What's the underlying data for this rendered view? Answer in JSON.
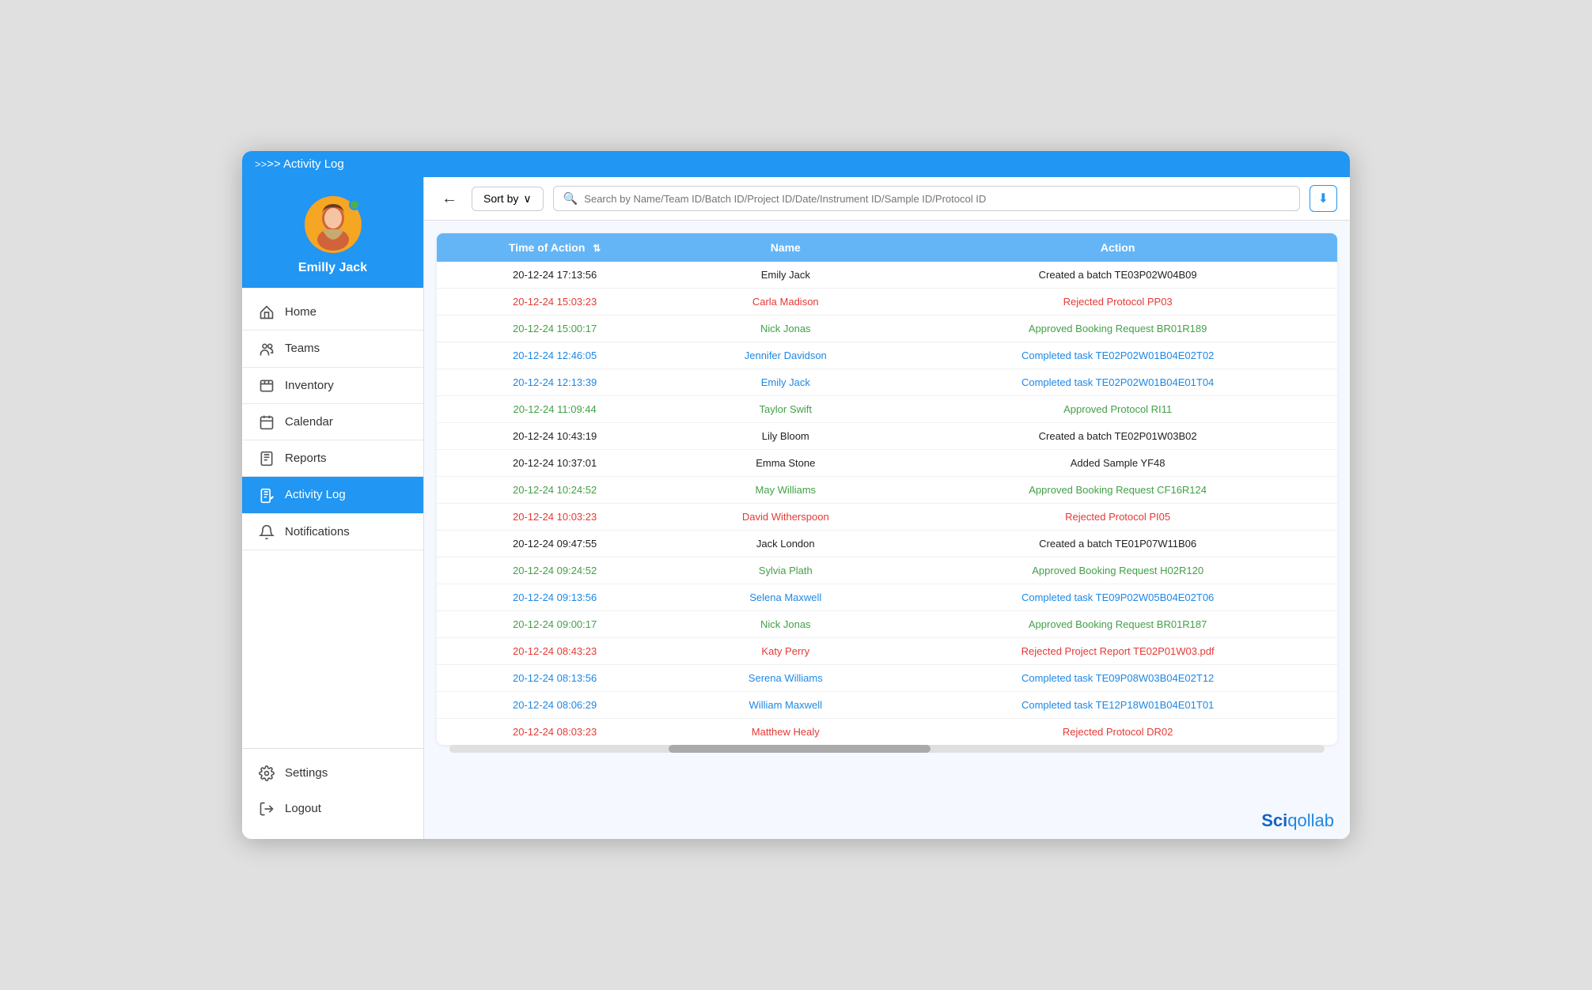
{
  "window": {
    "title": ">> Activity Log"
  },
  "sidebar": {
    "profile": {
      "name": "Emilly Jack",
      "online": true
    },
    "nav_items": [
      {
        "id": "home",
        "label": "Home",
        "icon": "home"
      },
      {
        "id": "teams",
        "label": "Teams",
        "icon": "teams"
      },
      {
        "id": "inventory",
        "label": "Inventory",
        "icon": "inventory"
      },
      {
        "id": "calendar",
        "label": "Calendar",
        "icon": "calendar"
      },
      {
        "id": "reports",
        "label": "Reports",
        "icon": "reports"
      },
      {
        "id": "activity-log",
        "label": "Activity Log",
        "icon": "activity-log",
        "active": true
      },
      {
        "id": "notifications",
        "label": "Notifications",
        "icon": "notifications"
      }
    ],
    "bottom_items": [
      {
        "id": "settings",
        "label": "Settings",
        "icon": "settings"
      },
      {
        "id": "logout",
        "label": "Logout",
        "icon": "logout"
      }
    ]
  },
  "toolbar": {
    "back_label": "←",
    "sort_label": "Sort by",
    "search_placeholder": "Search by Name/Team ID/Batch ID/Project ID/Date/Instrument ID/Sample ID/Protocol ID"
  },
  "table": {
    "columns": [
      {
        "key": "time",
        "label": "Time of Action"
      },
      {
        "key": "name",
        "label": "Name"
      },
      {
        "key": "action",
        "label": "Action"
      }
    ],
    "rows": [
      {
        "time": "20-12-24 17:13:56",
        "name": "Emily Jack",
        "action": "Created a batch TE03P02W04B09",
        "color": "black"
      },
      {
        "time": "20-12-24 15:03:23",
        "name": "Carla Madison",
        "action": "Rejected Protocol PP03",
        "color": "red"
      },
      {
        "time": "20-12-24 15:00:17",
        "name": "Nick Jonas",
        "action": "Approved Booking Request BR01R189",
        "color": "green"
      },
      {
        "time": "20-12-24 12:46:05",
        "name": "Jennifer Davidson",
        "action": "Completed task TE02P02W01B04E02T02",
        "color": "blue"
      },
      {
        "time": "20-12-24 12:13:39",
        "name": "Emily Jack",
        "action": "Completed task TE02P02W01B04E01T04",
        "color": "blue"
      },
      {
        "time": "20-12-24 11:09:44",
        "name": "Taylor Swift",
        "action": "Approved Protocol RI11",
        "color": "green"
      },
      {
        "time": "20-12-24 10:43:19",
        "name": "Lily Bloom",
        "action": "Created a batch TE02P01W03B02",
        "color": "black"
      },
      {
        "time": "20-12-24 10:37:01",
        "name": "Emma Stone",
        "action": "Added Sample YF48",
        "color": "black"
      },
      {
        "time": "20-12-24 10:24:52",
        "name": "May Williams",
        "action": "Approved Booking Request CF16R124",
        "color": "green"
      },
      {
        "time": "20-12-24 10:03:23",
        "name": "David Witherspoon",
        "action": "Rejected Protocol PI05",
        "color": "red"
      },
      {
        "time": "20-12-24 09:47:55",
        "name": "Jack London",
        "action": "Created a batch TE01P07W11B06",
        "color": "black"
      },
      {
        "time": "20-12-24 09:24:52",
        "name": "Sylvia Plath",
        "action": "Approved Booking Request H02R120",
        "color": "green"
      },
      {
        "time": "20-12-24 09:13:56",
        "name": "Selena Maxwell",
        "action": "Completed task TE09P02W05B04E02T06",
        "color": "blue"
      },
      {
        "time": "20-12-24 09:00:17",
        "name": "Nick Jonas",
        "action": "Approved Booking Request BR01R187",
        "color": "green"
      },
      {
        "time": "20-12-24 08:43:23",
        "name": "Katy Perry",
        "action": "Rejected Project Report TE02P01W03.pdf",
        "color": "red"
      },
      {
        "time": "20-12-24 08:13:56",
        "name": "Serena Williams",
        "action": "Completed task TE09P08W03B04E02T12",
        "color": "blue"
      },
      {
        "time": "20-12-24 08:06:29",
        "name": "William Maxwell",
        "action": "Completed task TE12P18W01B04E01T01",
        "color": "blue"
      },
      {
        "time": "20-12-24 08:03:23",
        "name": "Matthew Healy",
        "action": "Rejected Protocol DR02",
        "color": "red"
      }
    ]
  },
  "brand": {
    "name_bold": "Sci",
    "name_light": "qollab"
  }
}
